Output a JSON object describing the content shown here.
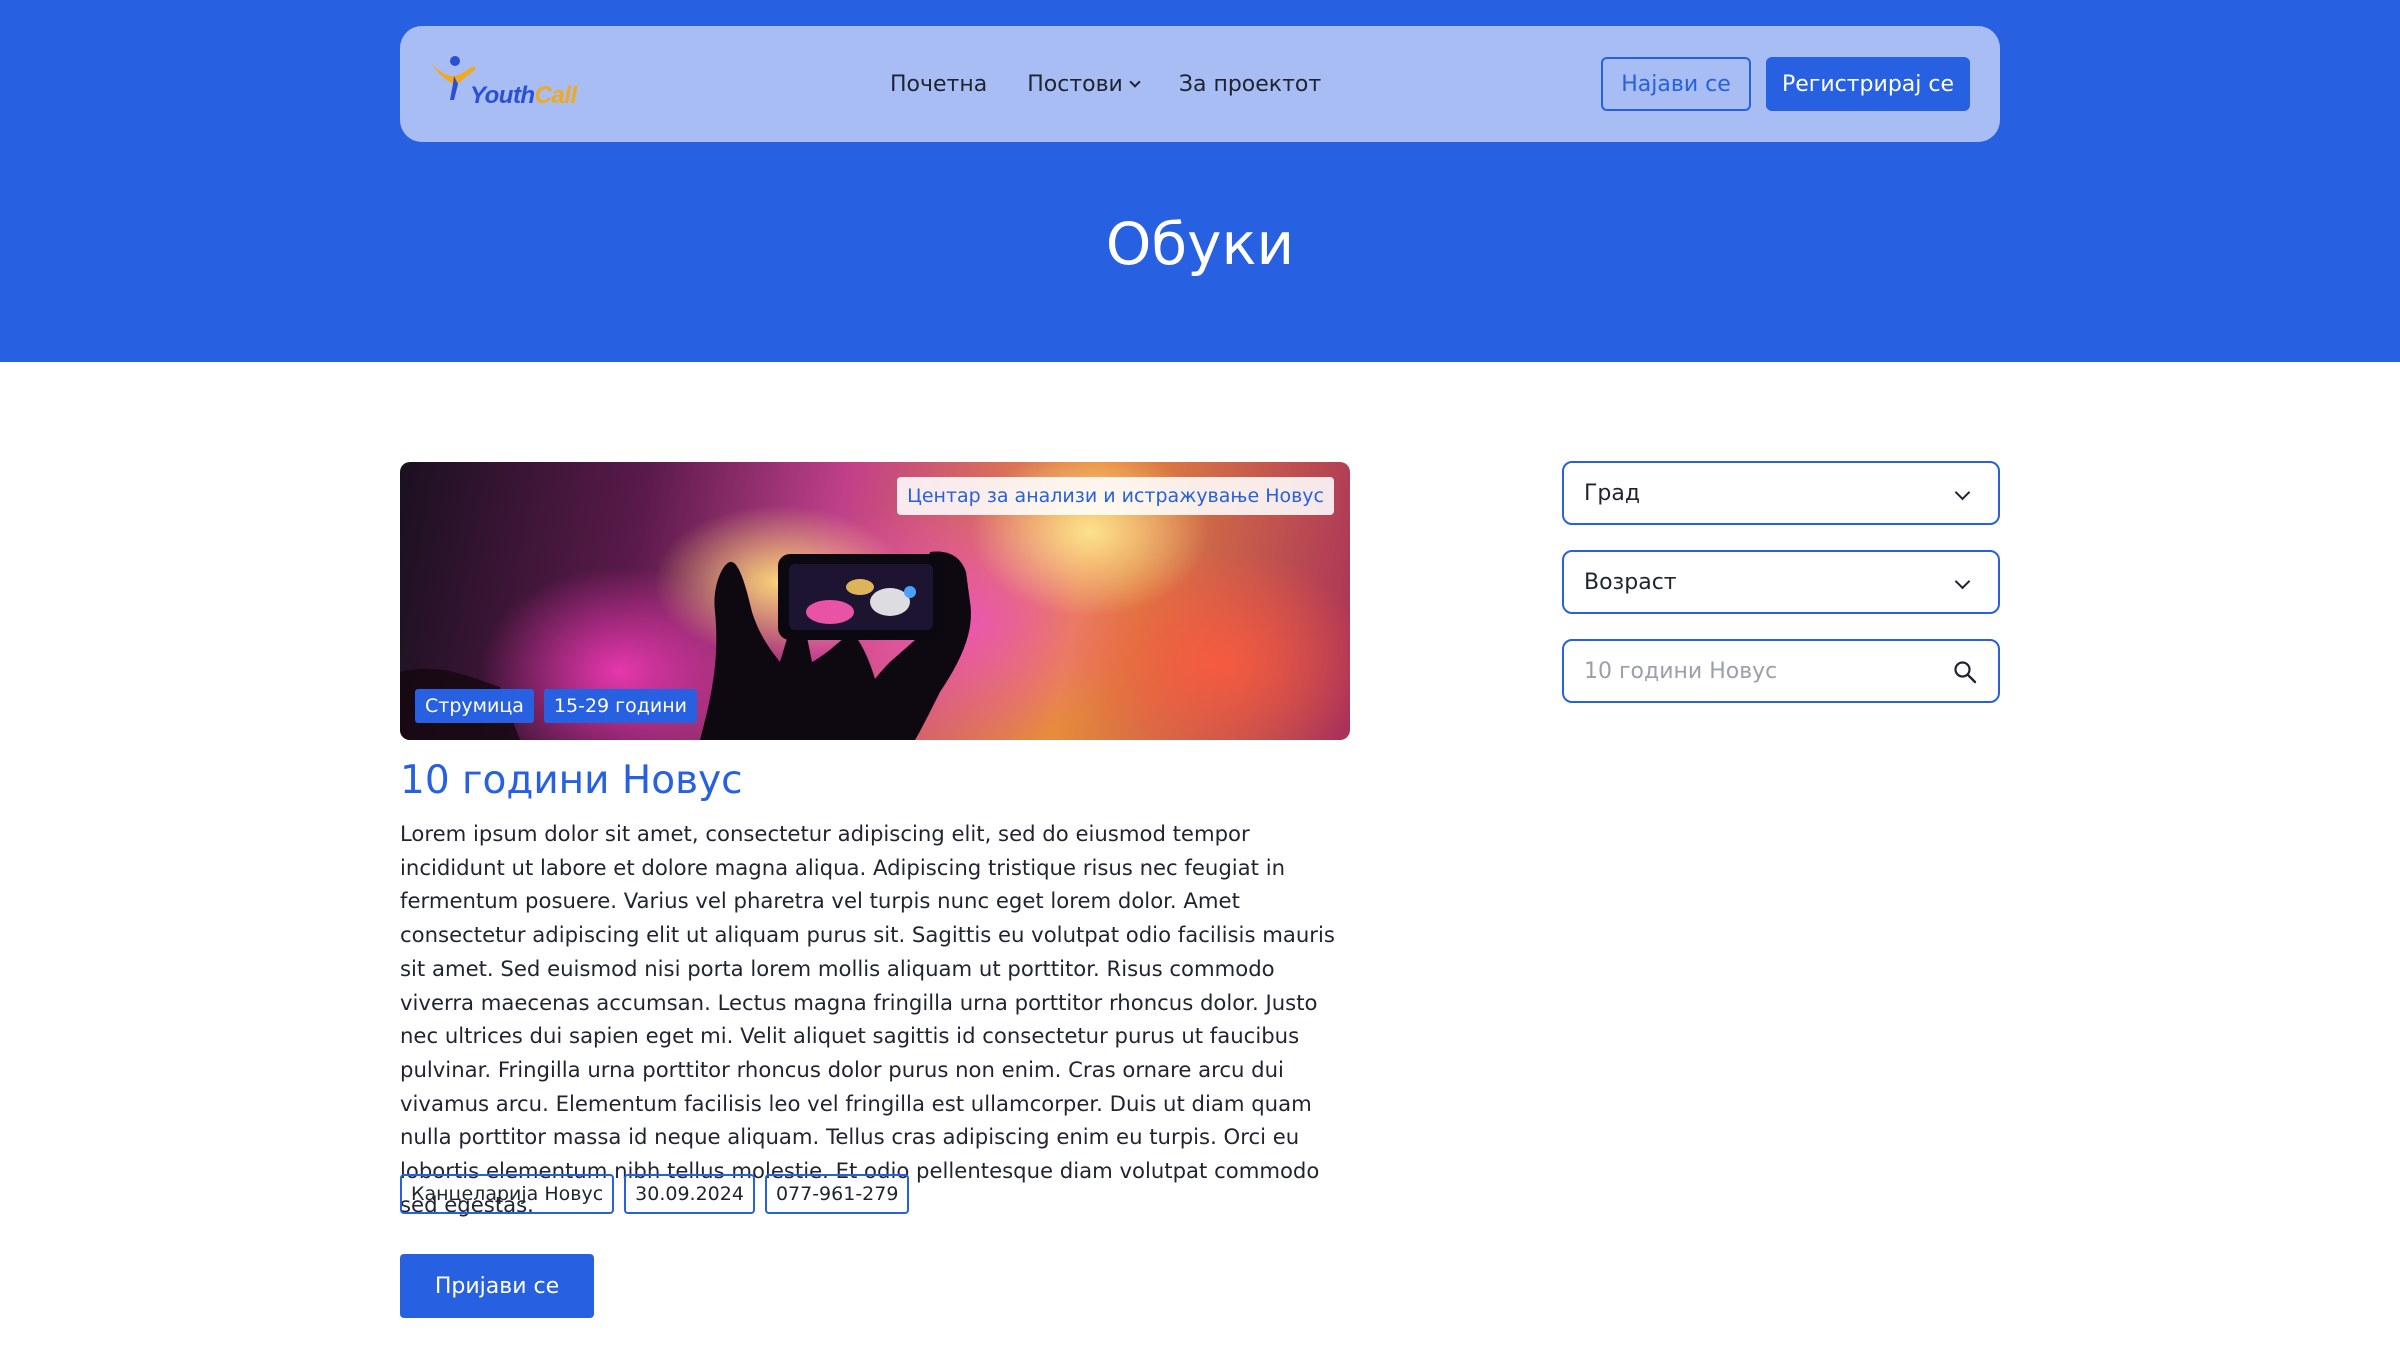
{
  "brand": {
    "name_part1": "Youth",
    "name_part2": "Call",
    "colors": {
      "primary": "#2760e0",
      "navbar_bg": "#a7bdf3",
      "logo_blue": "#2a4fd1",
      "logo_orange": "#f2a91c"
    }
  },
  "nav": {
    "items": [
      {
        "label": "Почетна"
      },
      {
        "label": "Постови",
        "has_dropdown": true
      },
      {
        "label": "За проектот"
      }
    ],
    "login_label": "Најави се",
    "register_label": "Регистрирај се"
  },
  "page": {
    "title": "Обуки"
  },
  "post": {
    "organization": "Центар за анализи и истражување Новус",
    "image_tags": [
      "Струмица",
      "15-29 години"
    ],
    "title": "10 години Новус",
    "body": "Lorem ipsum dolor sit amet, consectetur adipiscing elit, sed do eiusmod tempor incididunt ut labore et dolore magna aliqua. Adipiscing tristique risus nec feugiat in fermentum posuere. Varius vel pharetra vel turpis nunc eget lorem dolor. Amet consectetur adipiscing elit ut aliquam purus sit. Sagittis eu volutpat odio facilisis mauris sit amet. Sed euismod nisi porta lorem mollis aliquam ut porttitor. Risus commodo viverra maecenas accumsan. Lectus magna fringilla urna porttitor rhoncus dolor. Justo nec ultrices dui sapien eget mi. Velit aliquet sagittis id consectetur purus ut faucibus pulvinar. Fringilla urna porttitor rhoncus dolor purus non enim. Cras ornare arcu dui vivamus arcu. Elementum facilisis leo vel fringilla est ullamcorper. Duis ut diam quam nulla porttitor massa id neque aliquam. Tellus cras adipiscing enim eu turpis. Orci eu lobortis elementum nibh tellus molestie. Et odio pellentesque diam volutpat commodo sed egestas.",
    "meta": {
      "location": "Канцеларија Новус",
      "date": "30.09.2024",
      "phone": "077-961-279"
    },
    "apply_label": "Пријави се"
  },
  "filters": {
    "city_label": "Град",
    "age_label": "Возраст",
    "search_placeholder": "10 години Новус",
    "icons": {
      "dropdown": "chevron-down-icon",
      "search": "search-icon"
    }
  }
}
